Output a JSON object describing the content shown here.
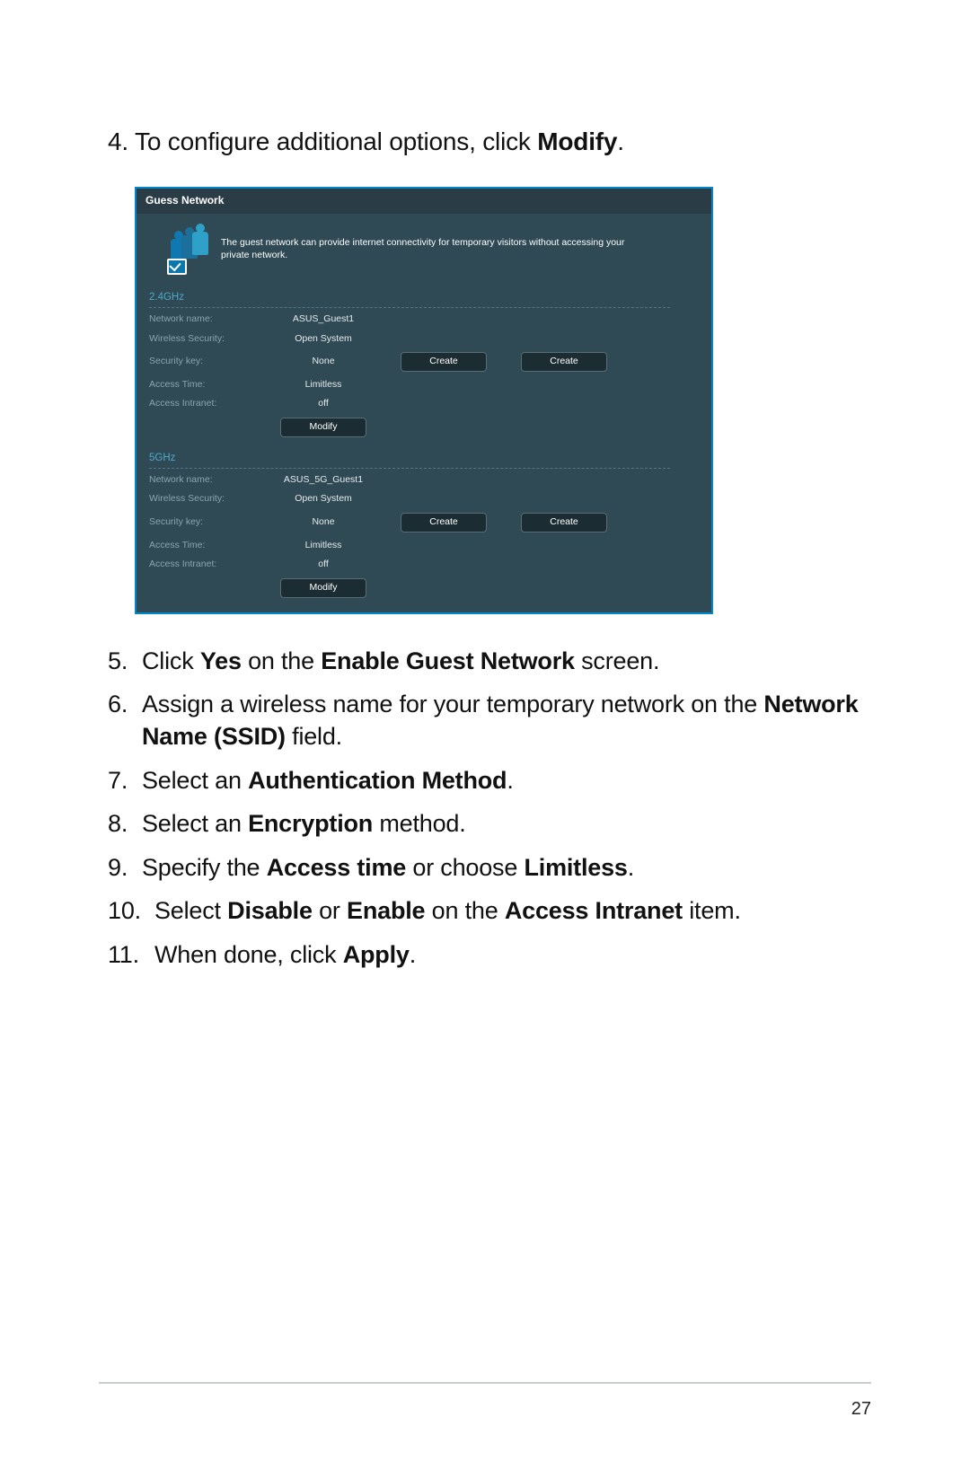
{
  "step4": {
    "prefix": "4.  To configure additional options, click ",
    "bold": "Modify",
    "suffix": "."
  },
  "screenshot": {
    "title": "Guess Network",
    "description": "The guest network can provide internet connectivity for temporary visitors without accessing your private network.",
    "sections": {
      "a": {
        "heading": "2.4GHz",
        "rows": {
          "name_lbl": "Network name:",
          "name_val": "ASUS_Guest1",
          "sec_lbl": "Wireless Security:",
          "sec_val": "Open System",
          "key_lbl": "Security key:",
          "key_val": "None",
          "time_lbl": "Access Time:",
          "time_val": "Limitless",
          "intr_lbl": "Access Intranet:",
          "intr_val": "off"
        },
        "btn_create": "Create",
        "btn_modify": "Modify"
      },
      "b": {
        "heading": "5GHz",
        "rows": {
          "name_lbl": "Network name:",
          "name_val": "ASUS_5G_Guest1",
          "sec_lbl": "Wireless Security:",
          "sec_val": "Open System",
          "key_lbl": "Security key:",
          "key_val": "None",
          "time_lbl": "Access Time:",
          "time_val": "Limitless",
          "intr_lbl": "Access Intranet:",
          "intr_val": "off"
        },
        "btn_create": "Create",
        "btn_modify": "Modify"
      }
    }
  },
  "steps": {
    "s5": {
      "n": "5.  ",
      "p1": "Click ",
      "b1": "Yes",
      "p2": " on the ",
      "b2": "Enable Guest Network",
      "p3": " screen."
    },
    "s6": {
      "n": "6.  ",
      "p1": "Assign a wireless name for your temporary network on the ",
      "b1": "Network Name (SSID)",
      "p2": " field."
    },
    "s7": {
      "n": "7.  ",
      "p1": "Select an ",
      "b1": "Authentication Method",
      "p2": "."
    },
    "s8": {
      "n": "8.  ",
      "p1": "Select an ",
      "b1": "Encryption",
      "p2": " method."
    },
    "s9": {
      "n": "9.  ",
      "p1": "Specify the ",
      "b1": "Access time",
      "p2": " or choose ",
      "b2": "Limitless",
      "p3": "."
    },
    "s10": {
      "n": "10. ",
      "p1": "Select ",
      "b1": "Disable",
      "p2": " or ",
      "b2": "Enable",
      "p3": " on the ",
      "b3": "Access Intranet",
      "p4": " item."
    },
    "s11": {
      "n": "11. ",
      "p1": "When done, click ",
      "b1": "Apply",
      "p2": "."
    }
  },
  "page_number": "27"
}
